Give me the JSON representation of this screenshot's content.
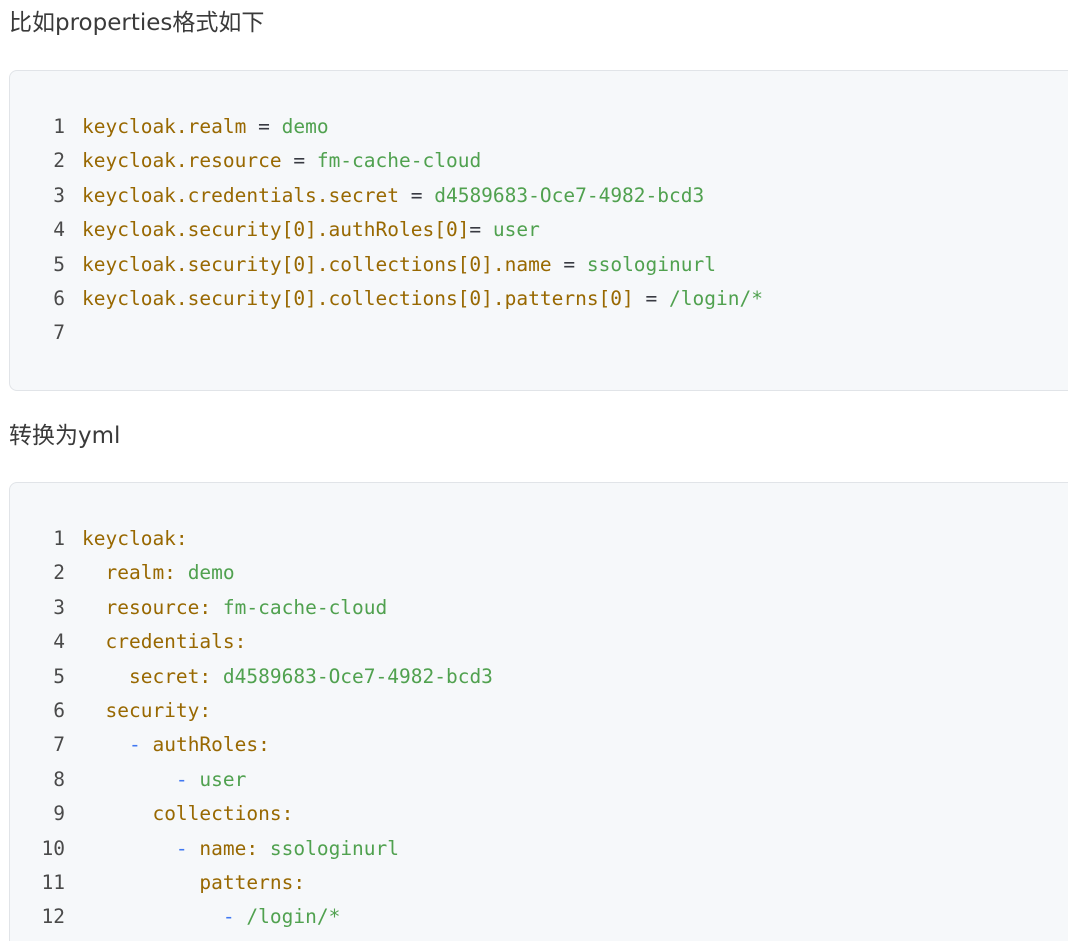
{
  "paragraphs": {
    "intro": "比如properties格式如下",
    "convert": "转换为yml"
  },
  "properties_block": {
    "lines": [
      [
        {
          "t": "key",
          "s": "keycloak.realm"
        },
        {
          "t": "op",
          "s": " = "
        },
        {
          "t": "val",
          "s": "demo"
        }
      ],
      [
        {
          "t": "key",
          "s": "keycloak.resource"
        },
        {
          "t": "op",
          "s": " = "
        },
        {
          "t": "val",
          "s": "fm-cache-cloud"
        }
      ],
      [
        {
          "t": "key",
          "s": "keycloak.credentials.secret"
        },
        {
          "t": "op",
          "s": " = "
        },
        {
          "t": "val",
          "s": "d4589683-Oce7-4982-bcd3"
        }
      ],
      [
        {
          "t": "key",
          "s": "keycloak.security[0].authRoles[0]"
        },
        {
          "t": "op",
          "s": "= "
        },
        {
          "t": "val",
          "s": "user"
        }
      ],
      [
        {
          "t": "key",
          "s": "keycloak.security[0].collections[0].name"
        },
        {
          "t": "op",
          "s": " = "
        },
        {
          "t": "val",
          "s": "ssologinurl"
        }
      ],
      [
        {
          "t": "key",
          "s": "keycloak.security[0].collections[0].patterns[0]"
        },
        {
          "t": "op",
          "s": " = "
        },
        {
          "t": "val",
          "s": "/login/*"
        }
      ],
      []
    ]
  },
  "yml_block": {
    "lines": [
      [
        {
          "t": "key",
          "s": "keycloak:"
        }
      ],
      [
        {
          "t": "op",
          "s": "  "
        },
        {
          "t": "key",
          "s": "realm:"
        },
        {
          "t": "op",
          "s": " "
        },
        {
          "t": "val",
          "s": "demo"
        }
      ],
      [
        {
          "t": "op",
          "s": "  "
        },
        {
          "t": "key",
          "s": "resource:"
        },
        {
          "t": "op",
          "s": " "
        },
        {
          "t": "val",
          "s": "fm-cache-cloud"
        }
      ],
      [
        {
          "t": "op",
          "s": "  "
        },
        {
          "t": "key",
          "s": "credentials:"
        }
      ],
      [
        {
          "t": "op",
          "s": "    "
        },
        {
          "t": "key",
          "s": "secret:"
        },
        {
          "t": "op",
          "s": " "
        },
        {
          "t": "val",
          "s": "d4589683-Oce7-4982-bcd3"
        }
      ],
      [
        {
          "t": "op",
          "s": "  "
        },
        {
          "t": "key",
          "s": "security:"
        }
      ],
      [
        {
          "t": "op",
          "s": "    "
        },
        {
          "t": "dash",
          "s": "-"
        },
        {
          "t": "op",
          "s": " "
        },
        {
          "t": "key",
          "s": "authRoles:"
        }
      ],
      [
        {
          "t": "op",
          "s": "        "
        },
        {
          "t": "dash",
          "s": "-"
        },
        {
          "t": "op",
          "s": " "
        },
        {
          "t": "val",
          "s": "user"
        }
      ],
      [
        {
          "t": "op",
          "s": "      "
        },
        {
          "t": "key",
          "s": "collections:"
        }
      ],
      [
        {
          "t": "op",
          "s": "        "
        },
        {
          "t": "dash",
          "s": "-"
        },
        {
          "t": "op",
          "s": " "
        },
        {
          "t": "key",
          "s": "name:"
        },
        {
          "t": "op",
          "s": " "
        },
        {
          "t": "val",
          "s": "ssologinurl"
        }
      ],
      [
        {
          "t": "op",
          "s": "          "
        },
        {
          "t": "key",
          "s": "patterns:"
        }
      ],
      [
        {
          "t": "op",
          "s": "            "
        },
        {
          "t": "dash",
          "s": "-"
        },
        {
          "t": "op",
          "s": " "
        },
        {
          "t": "val",
          "s": "/login/*"
        }
      ]
    ]
  },
  "colors": {
    "key": "#986801",
    "value": "#50a14f",
    "dash": "#4078f2",
    "code_background": "#f6f8fa"
  }
}
